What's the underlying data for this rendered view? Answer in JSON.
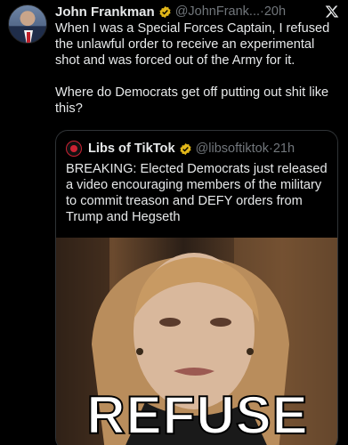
{
  "tweet": {
    "author_name": "John Frankman",
    "author_handle": "@JohnFrank...",
    "separator": "·",
    "time": "20h",
    "paragraph_1": "When I was a Special Forces Captain, I refused the unlawful order to receive an experimental shot and was forced out of the Army for it.",
    "paragraph_2": "Where do Democrats get off putting out shit like this?"
  },
  "quoted_tweet": {
    "author_name": "Libs of TikTok",
    "author_handle": "@libsoftiktok",
    "separator": "·",
    "time": "21h",
    "text": "BREAKING: Elected Democrats just released a video encouraging members of the military to commit treason and DEFY orders from Trump and Hegseth",
    "media_caption": "REFUSE"
  },
  "icons": {
    "verified_badge": "verified-badge-icon",
    "x_logo": "x-logo-icon"
  },
  "colors": {
    "background": "#000000",
    "text": "#e7e9ea",
    "secondary_text": "#71767b",
    "verified_gold": "#e2b719",
    "border": "#2f3336"
  }
}
